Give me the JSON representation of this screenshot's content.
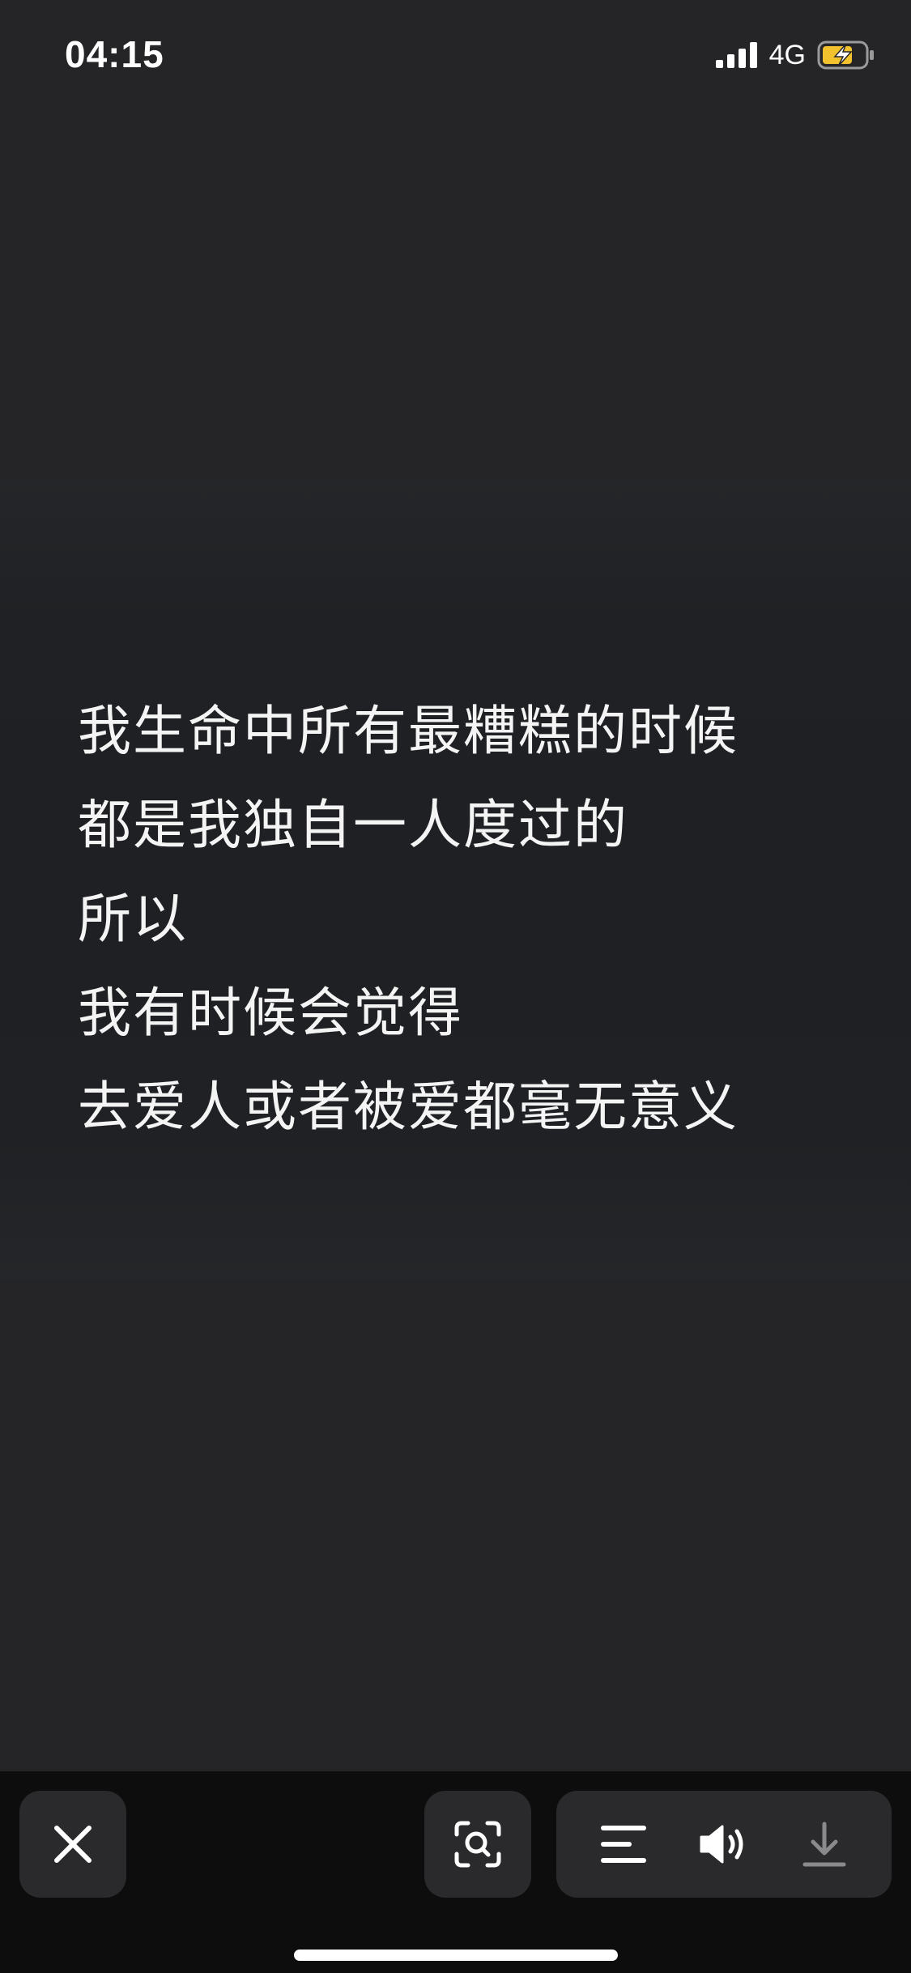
{
  "status_bar": {
    "time": "04:15",
    "network": "4G",
    "icons": [
      "signal-icon",
      "battery-charging-icon"
    ],
    "battery_color": "#f2c12e"
  },
  "content": {
    "lyrics": [
      "我生命中所有最糟糕的时候",
      "都是我独自一人度过的",
      "所以",
      "我有时候会觉得",
      "去爱人或者被爱都毫无意义"
    ]
  },
  "toolbar": {
    "buttons": [
      "close-icon",
      "scan-icon",
      "menu-icon",
      "volume-icon",
      "download-icon"
    ]
  }
}
